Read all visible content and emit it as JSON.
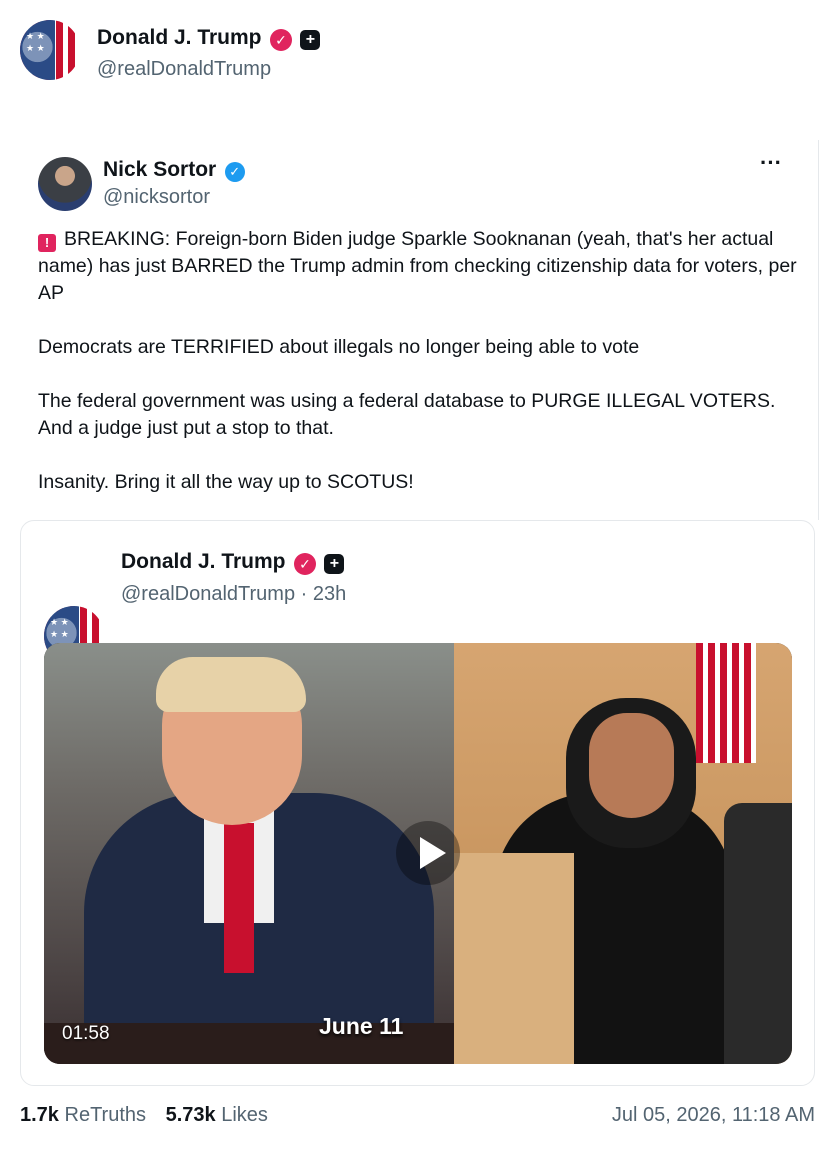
{
  "post": {
    "author_name": "Donald J. Trump",
    "author_handle": "@realDonaldTrump"
  },
  "quoted": {
    "author_name": "Nick Sortor",
    "author_handle": "@nicksortor",
    "more_label": "···",
    "paragraphs": [
      "BREAKING: Foreign-born Biden judge Sparkle Sooknanan (yeah, that's her actual name) has just BARRED the Trump admin from checking citizenship data for voters, per AP",
      "Democrats are TERRIFIED about illegals no longer being able to vote",
      "The federal government was using a federal database to PURGE ILLEGAL VOTERS. And a judge just put a stop to that.",
      "Insanity. Bring it all the way up to SCOTUS!"
    ]
  },
  "embedded": {
    "author_name": "Donald J. Trump",
    "author_handle": "@realDonaldTrump",
    "time_ago": "· 23h",
    "video": {
      "duration": "01:58",
      "overlay_text": "June 11"
    }
  },
  "stats": {
    "retruths_count": "1.7k",
    "retruths_label": "ReTruths",
    "likes_count": "5.73k",
    "likes_label": "Likes",
    "timestamp": "Jul 05, 2026, 11:18 AM"
  },
  "icons": {
    "verified_pink": "verified-badge-icon",
    "plus": "plus-badge-icon",
    "verified_blue": "verified-check-icon",
    "alert": "alert-siren-icon",
    "play": "play-icon"
  },
  "colors": {
    "verified_pink": "#e0245e",
    "verified_blue": "#1d9bf0",
    "text_secondary": "#536471"
  }
}
